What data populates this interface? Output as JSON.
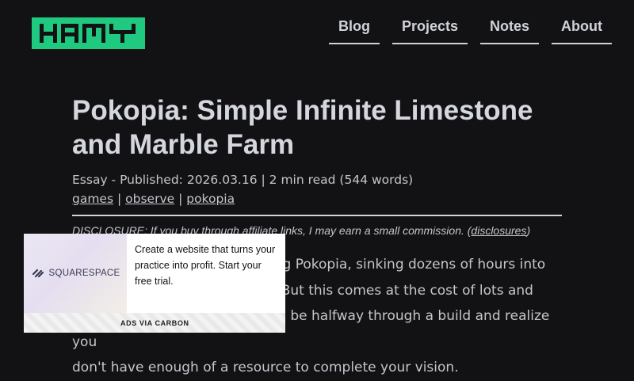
{
  "site": {
    "logo_text": "HAMY",
    "logo_color": "#1fc97f"
  },
  "nav": {
    "items": [
      {
        "label": "Blog"
      },
      {
        "label": "Projects"
      },
      {
        "label": "Notes"
      },
      {
        "label": "About"
      }
    ]
  },
  "article": {
    "title": "Pokopia: Simple Infinite Limestone and Marble Farm",
    "meta": "Essay - Published: 2026.03.16 | 2 min read (544 words)",
    "tags": [
      "games",
      "observe",
      "pokopia"
    ],
    "tag_separator": " | ",
    "disclosure": {
      "label": "DISCLOSURE:",
      "text": " If you buy through affiliate links, I may earn a small commission. (",
      "link": "disclosures",
      "close": ")"
    },
    "para_lines": [
      "I've been really enjoying playing Pokopia, sinking dozens of hours into",
      "building up its various islands. But this comes at the cost of lots and",
      "lots of resources and it sucks to be halfway through a build and realize you",
      "don't have enough of a resource to complete your vision."
    ]
  },
  "ad": {
    "brand": "SQUARESPACE",
    "copy": "Create a website that turns your practice into profit. Start your free trial.",
    "footer": "ADS VIA CARBON"
  }
}
